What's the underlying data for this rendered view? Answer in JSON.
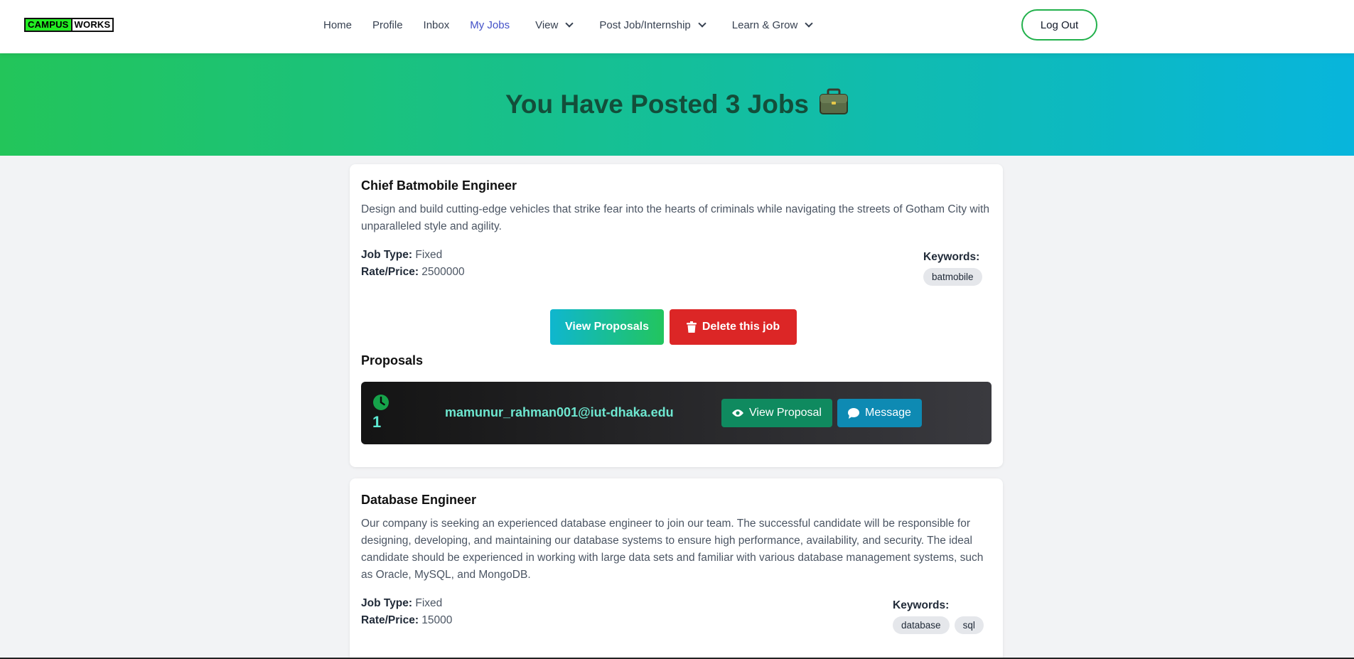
{
  "brand": {
    "part1": "CAMPUS",
    "part2": "WORKS"
  },
  "nav": {
    "links": [
      {
        "label": "Home"
      },
      {
        "label": "Profile"
      },
      {
        "label": "Inbox"
      },
      {
        "label": "My Jobs",
        "active": true
      },
      {
        "label": "View",
        "dropdown": true
      },
      {
        "label": "Post Job/Internship",
        "dropdown": true
      },
      {
        "label": "Learn & Grow",
        "dropdown": true
      }
    ],
    "logout": "Log Out"
  },
  "hero": {
    "title": "You Have Posted 3 Jobs"
  },
  "jobs": [
    {
      "title": "Chief Batmobile Engineer",
      "description": "Design and build cutting-edge vehicles that strike fear into the hearts of criminals while navigating the streets of Gotham City with unparalleled style and agility.",
      "job_type_label": "Job Type:",
      "job_type": "Fixed",
      "rate_label": "Rate/Price:",
      "rate": "2500000",
      "keywords_label": "Keywords:",
      "keywords": [
        "batmobile"
      ],
      "view_proposals": "View Proposals",
      "delete": "Delete this job",
      "proposals_title": "Proposals",
      "proposals": [
        {
          "number": "1",
          "email": "mamunur_rahman001@iut-dhaka.edu",
          "view": "View Proposal",
          "message": "Message"
        }
      ]
    },
    {
      "title": "Database Engineer",
      "description": "Our company is seeking an experienced database engineer to join our team. The successful candidate will be responsible for designing, developing, and maintaining our database systems to ensure high performance, availability, and security. The ideal candidate should be experienced in working with large data sets and familiar with various database management systems, such as Oracle, MySQL, and MongoDB.",
      "job_type_label": "Job Type:",
      "job_type": "Fixed",
      "rate_label": "Rate/Price:",
      "rate": "15000",
      "keywords_label": "Keywords:",
      "keywords": [
        "database",
        "sql"
      ]
    }
  ],
  "colors": {
    "accent_green": "#22c55e",
    "accent_cyan": "#06b6d4",
    "danger": "#dc2626",
    "nav_active": "#4250c8"
  }
}
